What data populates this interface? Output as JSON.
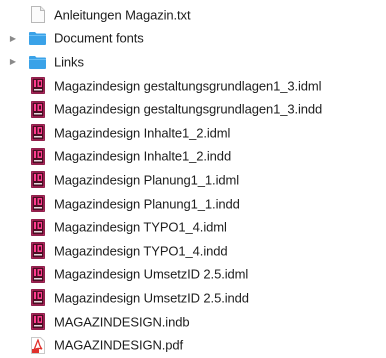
{
  "files": [
    {
      "name": "Anleitungen Magazin.txt",
      "icon": "text-file-icon",
      "disclosure": false
    },
    {
      "name": "Document fonts",
      "icon": "folder-icon",
      "disclosure": true
    },
    {
      "name": "Links",
      "icon": "folder-icon",
      "disclosure": true
    },
    {
      "name": "Magazindesign gestaltungsgrundlagen1_3.idml",
      "icon": "indesign-file-icon",
      "disclosure": false
    },
    {
      "name": "Magazindesign gestaltungsgrundlagen1_3.indd",
      "icon": "indesign-file-icon",
      "disclosure": false
    },
    {
      "name": "Magazindesign Inhalte1_2.idml",
      "icon": "indesign-file-icon",
      "disclosure": false
    },
    {
      "name": "Magazindesign Inhalte1_2.indd",
      "icon": "indesign-file-icon",
      "disclosure": false
    },
    {
      "name": "Magazindesign Planung1_1.idml",
      "icon": "indesign-file-icon",
      "disclosure": false
    },
    {
      "name": "Magazindesign Planung1_1.indd",
      "icon": "indesign-file-icon",
      "disclosure": false
    },
    {
      "name": "Magazindesign TYPO1_4.idml",
      "icon": "indesign-file-icon",
      "disclosure": false
    },
    {
      "name": "Magazindesign TYPO1_4.indd",
      "icon": "indesign-file-icon",
      "disclosure": false
    },
    {
      "name": "Magazindesign UmsetzID 2.5.idml",
      "icon": "indesign-file-icon",
      "disclosure": false
    },
    {
      "name": "Magazindesign UmsetzID 2.5.indd",
      "icon": "indesign-file-icon",
      "disclosure": false
    },
    {
      "name": "MAGAZINDESIGN.indb",
      "icon": "indesign-file-icon",
      "disclosure": false
    },
    {
      "name": "MAGAZINDESIGN.pdf",
      "icon": "pdf-file-icon",
      "disclosure": false
    }
  ],
  "colors": {
    "folder": "#3aa2e8",
    "indesign": "#4a0d22",
    "indesign_accent": "#ff3c8e",
    "pdf": "#e0312c"
  }
}
